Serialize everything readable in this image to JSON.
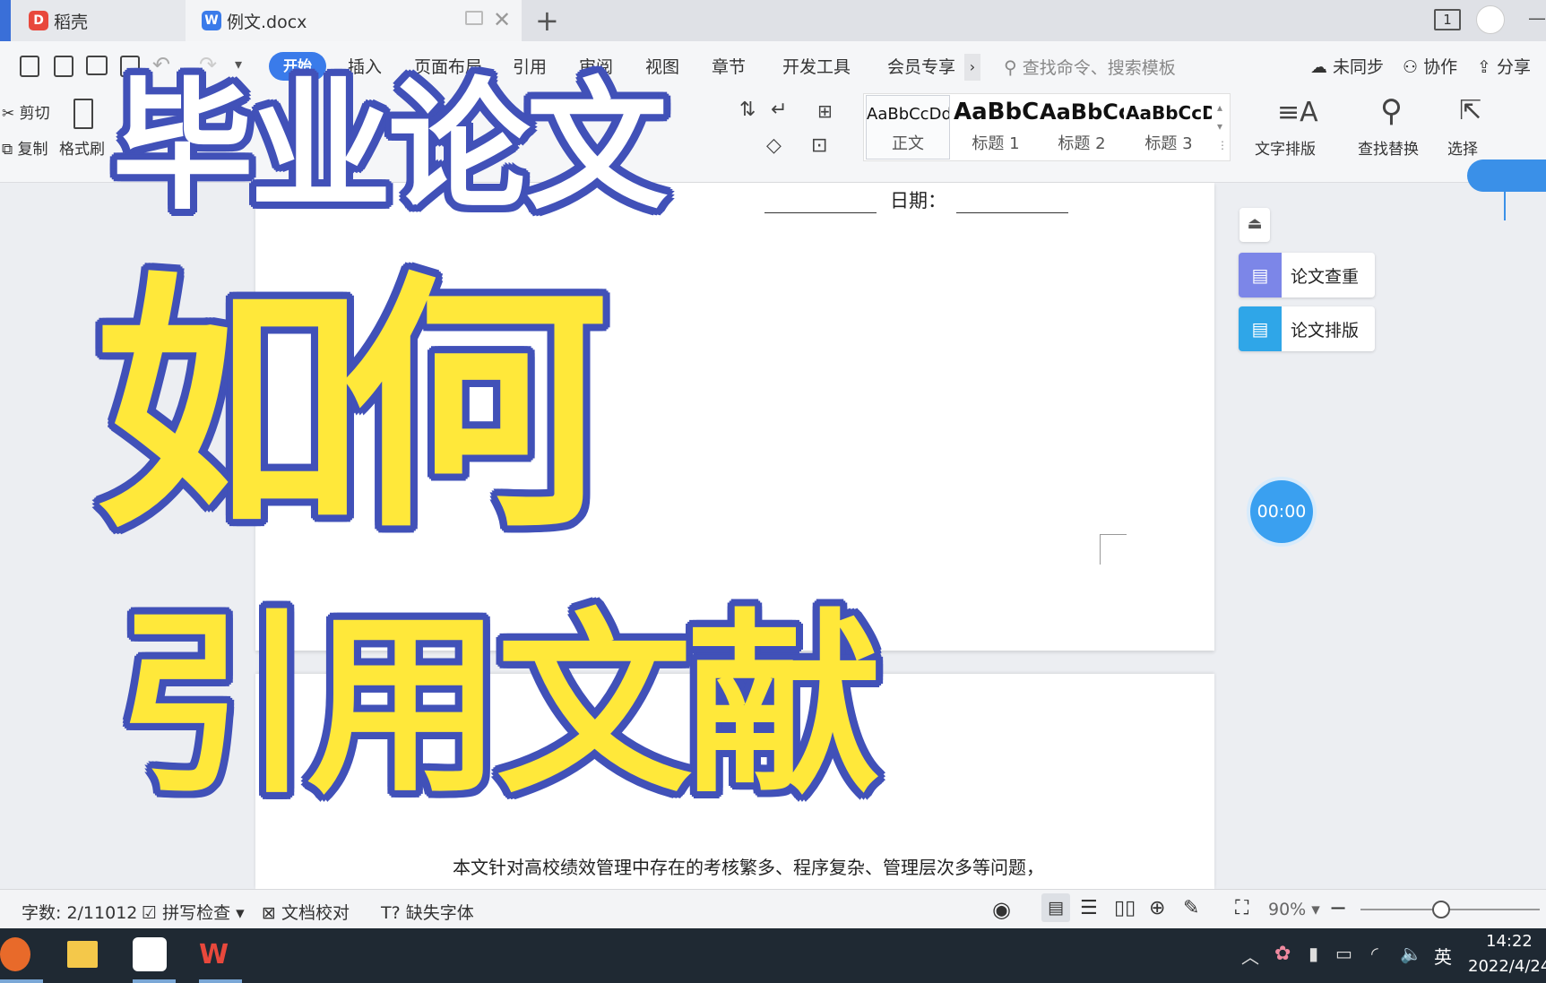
{
  "tabs": [
    {
      "label": "稻壳"
    },
    {
      "label": "例文.docx"
    }
  ],
  "titlebar": {
    "page_indicator": "1"
  },
  "menu": {
    "items": [
      "开始",
      "插入",
      "页面布局",
      "引用",
      "审阅",
      "视图",
      "章节",
      "开发工具",
      "会员专享"
    ],
    "search_placeholder": "查找命令、搜索模板",
    "sync": "未同步",
    "collab": "协作",
    "share": "分享"
  },
  "clipboard": {
    "cut": "剪切",
    "copy": "复制",
    "format_painter": "格式刷"
  },
  "styles": [
    {
      "sample": "AaBbCcDd",
      "name": "正文"
    },
    {
      "sample": "AaBbCc",
      "name": "标题 1"
    },
    {
      "sample": "AaBbCc",
      "name": "标题 2"
    },
    {
      "sample": "AaBbCcD",
      "name": "标题 3"
    }
  ],
  "tools": {
    "text_layout": "文字排版",
    "find_replace": "查找替换",
    "select": "选择"
  },
  "document": {
    "date_label": "日期：",
    "body_text": "本文针对高校绩效管理中存在的考核繁多、程序复杂、管理层次多等问题，"
  },
  "side_panel": {
    "plagiarism": "论文查重",
    "layout": "论文排版",
    "timer": "00:00"
  },
  "statusbar": {
    "word_count": "字数: 2/11012",
    "spell_check": "拼写检查",
    "proofread": "文档校对",
    "missing_fonts": "缺失字体",
    "zoom": "90%"
  },
  "taskbar": {
    "time": "14:22",
    "date": "2022/4/24",
    "ime": "英"
  },
  "overlay": {
    "line1": "毕业论文",
    "line2": "如何",
    "line3": "引用文献"
  },
  "colors": {
    "accent": "#3a7bea",
    "overlay_fill": "#ffe83a",
    "overlay_outline": "#4151b8"
  }
}
